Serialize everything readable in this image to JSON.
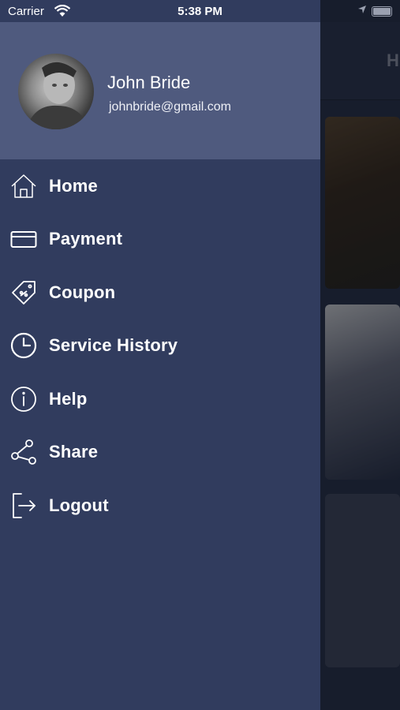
{
  "status_bar": {
    "carrier": "Carrier",
    "time": "5:38 PM"
  },
  "background": {
    "header_letter": "H"
  },
  "profile": {
    "name": "John Bride",
    "email": "johnbride@gmail.com"
  },
  "menu": {
    "items": [
      {
        "label": "Home",
        "icon": "home-icon"
      },
      {
        "label": "Payment",
        "icon": "card-icon"
      },
      {
        "label": "Coupon",
        "icon": "coupon-icon"
      },
      {
        "label": "Service History",
        "icon": "clock-icon"
      },
      {
        "label": "Help",
        "icon": "info-icon"
      },
      {
        "label": "Share",
        "icon": "share-icon"
      },
      {
        "label": "Logout",
        "icon": "logout-icon"
      }
    ]
  },
  "colors": {
    "drawer": "#313c5e",
    "profile_header": "#4f5a7e",
    "text": "#ffffff"
  }
}
